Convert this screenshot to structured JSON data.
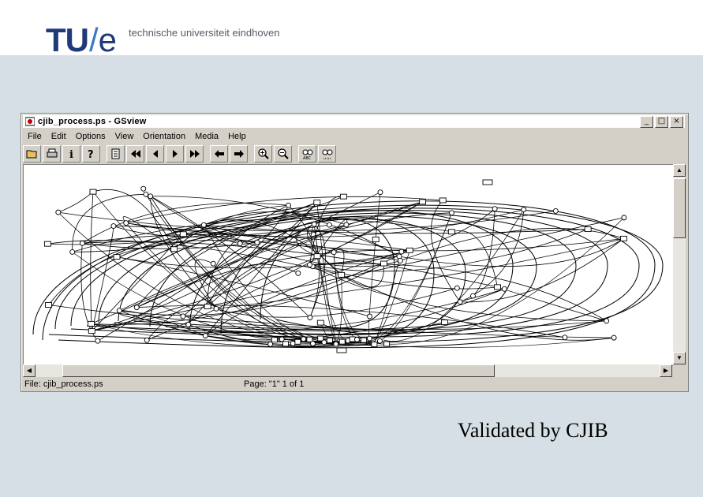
{
  "header": {
    "logo_tu": "TU",
    "logo_slash": "/",
    "logo_e": "e",
    "university": "technische universiteit eindhoven"
  },
  "window": {
    "title": "cjib_process.ps - GSview",
    "menu": [
      {
        "label": "File"
      },
      {
        "label": "Edit"
      },
      {
        "label": "Options"
      },
      {
        "label": "View"
      },
      {
        "label": "Orientation"
      },
      {
        "label": "Media"
      },
      {
        "label": "Help"
      }
    ],
    "toolbar_icons": [
      "open-icon",
      "print-icon",
      "info-icon",
      "help-icon",
      "goto-page-icon",
      "first-page-icon",
      "prev-page-icon",
      "next-page-icon",
      "last-page-icon",
      "back-icon",
      "forward-icon",
      "zoom-in-icon",
      "zoom-out-icon",
      "find-text-icon",
      "find-next-icon"
    ],
    "status": {
      "file": "File: cjib_process.ps",
      "page": "Page: \"1\"  1 of 1"
    }
  },
  "caption": "Validated by CJIB",
  "colors": {
    "background": "#d5dfe5",
    "logo": "#1e3a78",
    "logo_slash": "#3a78c2",
    "window_face": "#d4d0c8"
  }
}
